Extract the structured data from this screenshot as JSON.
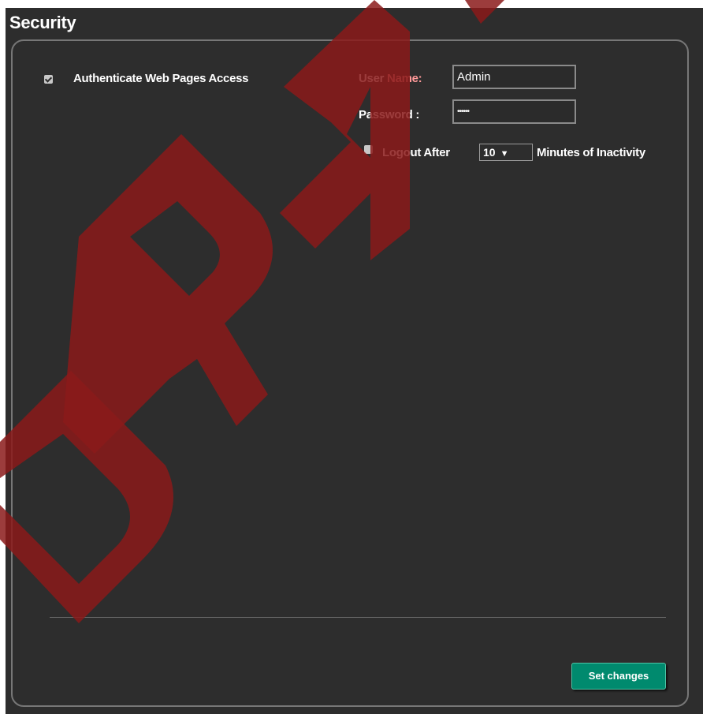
{
  "page": {
    "title": "Security"
  },
  "authentication": {
    "checkbox_label": "Authenticate Web Pages Access",
    "checked": true
  },
  "credentials": {
    "user_label_1": "User",
    "user_label_2": "Name:",
    "user_value": "Admin",
    "password_label": "Password :",
    "password_value": "••••••"
  },
  "logout": {
    "checked": false,
    "label": "Logout After",
    "minutes_selected": "10",
    "suffix": "Minutes of Inactivity"
  },
  "actions": {
    "set_changes_label": "Set changes"
  },
  "watermark": {
    "text": "DRAFT",
    "color": "#8b1a1a"
  },
  "colors": {
    "accent": "#008a6e",
    "panel_bg": "#2d2d2d",
    "label_highlight": "#ff9a9a"
  }
}
